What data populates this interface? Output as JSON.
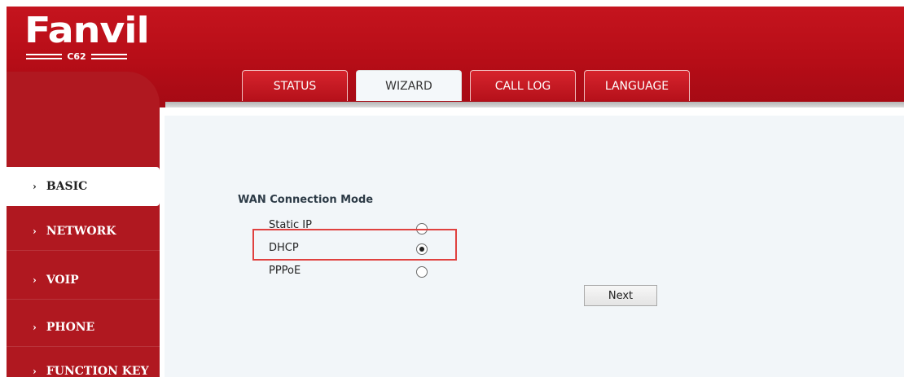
{
  "brand": {
    "logo_text": "Fanvil",
    "model": "C62"
  },
  "tabs": [
    {
      "label": "STATUS"
    },
    {
      "label": "WIZARD"
    },
    {
      "label": "CALL LOG"
    },
    {
      "label": "LANGUAGE"
    }
  ],
  "active_tab": "WIZARD",
  "sidebar": {
    "items": [
      {
        "label": "BASIC"
      },
      {
        "label": "NETWORK"
      },
      {
        "label": "VOIP"
      },
      {
        "label": "PHONE"
      },
      {
        "label": "FUNCTION KEY"
      }
    ],
    "active": "BASIC",
    "chevron": "›"
  },
  "wizard": {
    "section_title": "WAN Connection Mode",
    "options": [
      {
        "label": "Static IP",
        "checked": false
      },
      {
        "label": "DHCP",
        "checked": true
      },
      {
        "label": "PPPoE",
        "checked": false
      }
    ],
    "next_label": "Next"
  },
  "colors": {
    "brand_red": "#b60d17",
    "content_bg": "#f2f6f9",
    "highlight": "#e0413f"
  }
}
